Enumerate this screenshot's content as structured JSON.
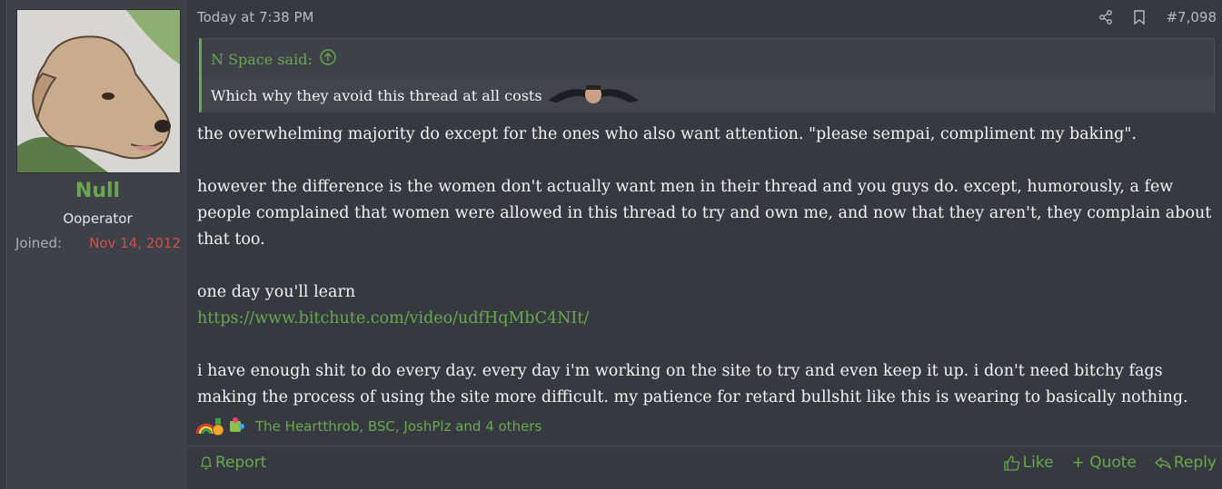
{
  "user": {
    "name": "Null",
    "title": "Ooperator",
    "joined_label": "Joined:",
    "joined_date": "Nov 14, 2012"
  },
  "post": {
    "timestamp": "Today at 7:38 PM",
    "number": "#7,098",
    "tools": [
      "share-icon",
      "bookmark-icon"
    ]
  },
  "quote": {
    "author": "N Space said:",
    "text": "Which why they avoid this thread at all costs"
  },
  "body": {
    "p1": "the overwhelming majority do except for the ones who also want attention. \"please sempai, compliment my baking\".",
    "p2": "however the difference is the women don't actually want men in their thread and you guys do. except, humorously, a few people complained that women were allowed in this thread to try and own me, and now that they aren't, they complain about that too.",
    "p3": "one day you'll learn",
    "link": "https://www.bitchute.com/video/udfHqMbC4NIt/",
    "p4": "i have enough shit to do every day. every day i'm working on the site to try and even keep it up. i don't need bitchy fags making the process of using the site more difficult. my patience for retard bullshit like this is wearing to basically nothing."
  },
  "reactions": {
    "text": "The Heartthrob, BSC, JoshPlz and 4 others",
    "icons": [
      "rainbow-icon",
      "medal-icon",
      "puzzle-icon"
    ]
  },
  "actions": {
    "report": "Report",
    "like": "Like",
    "quote": "+ Quote",
    "reply": "Reply"
  },
  "colors": {
    "accent": "#6aa84f",
    "joined_date": "#d0514c",
    "background": "#363a40",
    "sidebar": "#3e4148"
  }
}
